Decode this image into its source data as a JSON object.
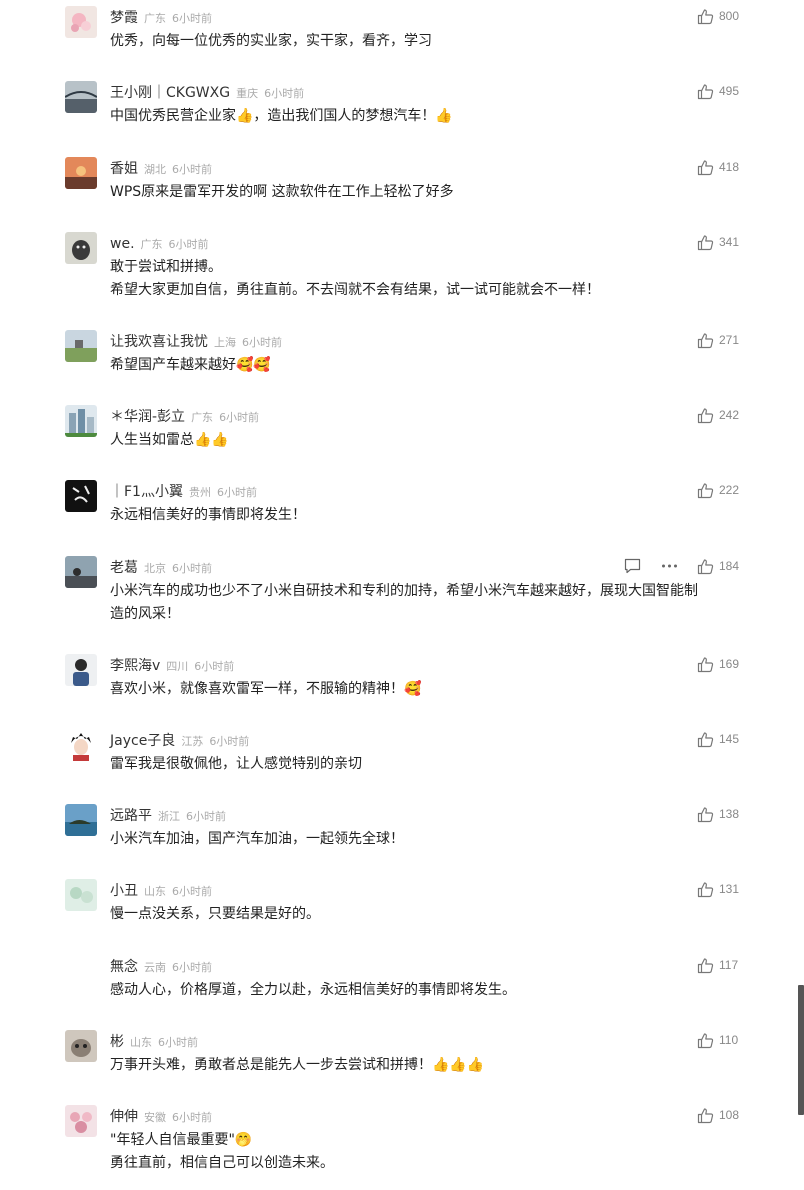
{
  "comments": [
    {
      "name": "梦霞",
      "loc": "广东",
      "time": "6小时前",
      "lines": [
        "优秀，向每一位优秀的实业家，实干家，看齐，学习"
      ],
      "likes": "800",
      "avatar": "flower-avatar"
    },
    {
      "name": "王小刚｜CKGWXG",
      "loc": "重庆",
      "time": "6小时前",
      "lines": [
        "中国优秀民营企业家👍，造出我们国人的梦想汽车！👍"
      ],
      "likes": "495",
      "avatar": "bridge-avatar"
    },
    {
      "name": "香姐",
      "loc": "湖北",
      "time": "6小时前",
      "lines": [
        "WPS原来是雷军开发的啊  这款软件在工作上轻松了好多"
      ],
      "likes": "418",
      "avatar": "sunset-avatar"
    },
    {
      "name": "we.",
      "loc": "广东",
      "time": "6小时前",
      "lines": [
        "敢于尝试和拼搏。",
        "希望大家更加自信，勇往直前。不去闯就不会有结果，试一试可能就会不一样！"
      ],
      "likes": "341",
      "avatar": "cat-avatar"
    },
    {
      "name": "让我欢喜让我忧",
      "loc": "上海",
      "time": "6小时前",
      "lines": [
        "希望国产车越来越好🥰🥰"
      ],
      "likes": "271",
      "avatar": "field-avatar"
    },
    {
      "name": "＊华润-彭立",
      "loc": "广东",
      "time": "6小时前",
      "lines": [
        "人生当如雷总👍👍"
      ],
      "likes": "242",
      "avatar": "building-avatar"
    },
    {
      "name": "｜F1灬小翼",
      "loc": "贵州",
      "time": "6小时前",
      "lines": [
        "永远相信美好的事情即将发生！"
      ],
      "likes": "222",
      "avatar": "calligraphy-avatar"
    },
    {
      "name": "老葛",
      "loc": "北京",
      "time": "6小时前",
      "lines": [
        "小米汽车的成功也少不了小米自研技术和专利的加持，希望小米汽车越来越好，展现大国智能制",
        "造的风采！"
      ],
      "likes": "184",
      "avatar": "road-avatar",
      "actions": true
    },
    {
      "name": "李熙海v",
      "loc": "四川",
      "time": "6小时前",
      "lines": [
        "喜欢小米，就像喜欢雷军一样，不服输的精神！🥰"
      ],
      "likes": "169",
      "avatar": "person-avatar"
    },
    {
      "name": "Jayce子良",
      "loc": "江苏",
      "time": "6小时前",
      "lines": [
        "雷军我是很敬佩他，让人感觉特别的亲切"
      ],
      "likes": "145",
      "avatar": "anime-avatar"
    },
    {
      "name": "远路平",
      "loc": "浙江",
      "time": "6小时前",
      "lines": [
        "小米汽车加油，国产汽车加油，一起领先全球！"
      ],
      "likes": "138",
      "avatar": "coast-avatar"
    },
    {
      "name": "小丑",
      "loc": "山东",
      "time": "6小时前",
      "lines": [
        "慢一点没关系，只要结果是好的。"
      ],
      "likes": "131",
      "avatar": "cartoon-avatar"
    },
    {
      "name": "無念",
      "loc": "云南",
      "time": "6小时前",
      "lines": [
        "感动人心，价格厚道，全力以赴，永远相信美好的事情即将发生。"
      ],
      "likes": "117",
      "avatar": "blank-avatar"
    },
    {
      "name": "彬",
      "loc": "山东",
      "time": "6小时前",
      "lines": [
        "万事开头难，勇敢者总是能先人一步去尝试和拼搏！👍👍👍"
      ],
      "likes": "110",
      "avatar": "kitten-avatar"
    },
    {
      "name": "伸伸",
      "loc": "安徽",
      "time": "6小时前",
      "lines": [
        "\"年轻人自信最重要\"🤭",
        "勇往直前，相信自己可以创造未来。"
      ],
      "likes": "108",
      "avatar": "flowers-avatar"
    }
  ],
  "colors": {
    "text": "#222222",
    "meta": "#aaaaaa",
    "like": "#888888"
  }
}
